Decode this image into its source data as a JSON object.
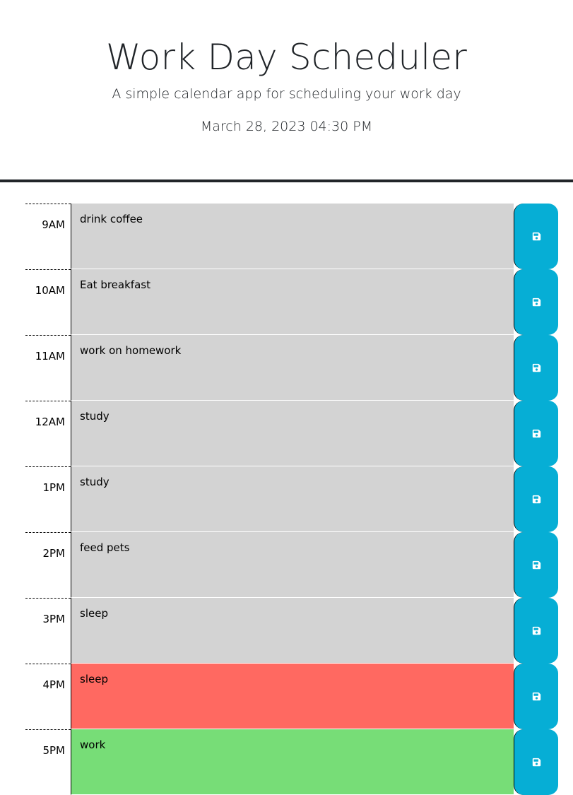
{
  "header": {
    "title": "Work Day Scheduler",
    "subtitle": "A simple calendar app for scheduling your work day",
    "current_day": "March 28, 2023 04:30 PM"
  },
  "time_blocks": [
    {
      "hour": "9AM",
      "text": "drink coffee",
      "state": "past"
    },
    {
      "hour": "10AM",
      "text": "Eat breakfast",
      "state": "past"
    },
    {
      "hour": "11AM",
      "text": "work on homework",
      "state": "past"
    },
    {
      "hour": "12AM",
      "text": "study",
      "state": "past"
    },
    {
      "hour": "1PM",
      "text": "study",
      "state": "past"
    },
    {
      "hour": "2PM",
      "text": "feed pets",
      "state": "past"
    },
    {
      "hour": "3PM",
      "text": "sleep",
      "state": "past"
    },
    {
      "hour": "4PM",
      "text": "sleep",
      "state": "present"
    },
    {
      "hour": "5PM",
      "text": "work",
      "state": "future"
    }
  ],
  "save_icon": "floppy-disk-icon",
  "colors": {
    "past": "#d3d3d3",
    "present": "#ff6961",
    "future": "#77dd77",
    "save_button": "#06aed5"
  }
}
